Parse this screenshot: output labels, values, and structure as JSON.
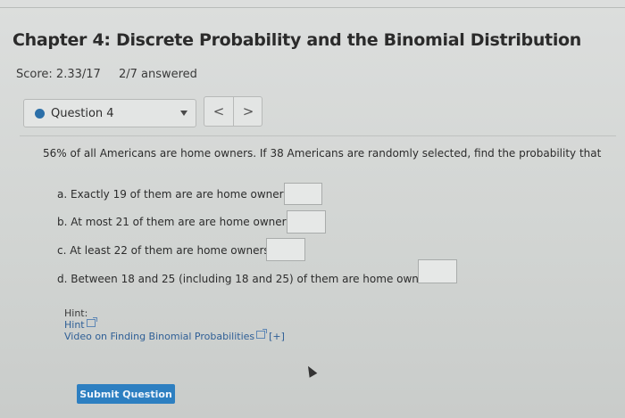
{
  "header": {
    "title": "Chapter 4: Discrete Probability and the Binomial Distribution",
    "score": "Score: 2.33/17",
    "answered": "2/7 answered"
  },
  "question_nav": {
    "selected": "Question 4",
    "prev_glyph": "<",
    "next_glyph": ">"
  },
  "question": {
    "prompt": "56% of all Americans are home owners. If 38 Americans are randomly selected, find the probability that",
    "parts": [
      {
        "label": "a. Exactly 19 of them are are home owners."
      },
      {
        "label": "b. At most 21 of them are are home owners."
      },
      {
        "label": "c. At least 22 of them are home owners."
      },
      {
        "label": "d. Between 18 and 25 (including 18 and 25) of them are home owners."
      }
    ]
  },
  "hints": {
    "title": "Hint:",
    "hint_link": "Hint",
    "video_link": "Video on Finding Binomial Probabilities",
    "expand": "[+]"
  },
  "submit_label": "Submit Question",
  "colors": {
    "accent": "#2d7fc1",
    "link": "#2f5f96",
    "dot": "#2b6fa8"
  }
}
